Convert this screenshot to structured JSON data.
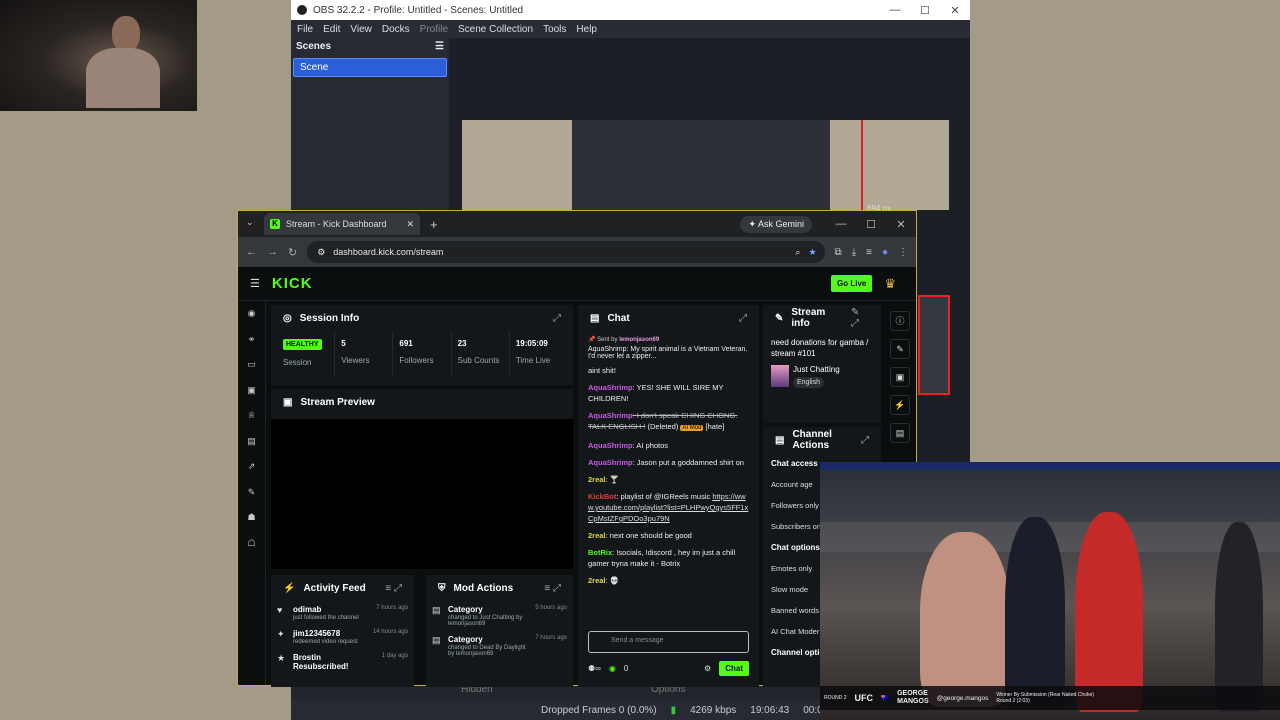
{
  "obs": {
    "title": "OBS 32.2.2 - Profile: Untitled - Scenes: Untitled",
    "menu": [
      "File",
      "Edit",
      "View",
      "Docks",
      "Profile",
      "Scene Collection",
      "Tools",
      "Help"
    ],
    "scenes_header": "Scenes",
    "scene_item": "Scene",
    "preview_px": "694 px",
    "status": {
      "dropped": "Dropped Frames 0 (0.0%)",
      "kbps": "4269 kbps",
      "time": "19:06:43",
      "rec": "00:00:00"
    },
    "dock_labels": [
      "Hidden",
      "Options"
    ]
  },
  "browser": {
    "tab_title": "Stream - Kick Dashboard",
    "ask_gemini": "Ask Gemini",
    "url": "dashboard.kick.com/stream"
  },
  "kick": {
    "logo": "KICK",
    "go_live": "Go Live",
    "session": {
      "title": "Session Info",
      "health": "HEALTHY",
      "health_label": "Session",
      "stats": [
        {
          "value": "5",
          "label": "Viewers"
        },
        {
          "value": "691",
          "label": "Followers"
        },
        {
          "value": "23",
          "label": "Sub Counts"
        },
        {
          "value": "19:05:09",
          "label": "Time Live"
        }
      ]
    },
    "preview_title": "Stream Preview",
    "activity": {
      "title": "Activity Feed",
      "items": [
        {
          "name": "odimab",
          "sub": "just followed the channel",
          "time": "7 hours ago"
        },
        {
          "name": "jim12345678",
          "sub": "redeemed video request",
          "time": "14 hours ago"
        },
        {
          "name": "Brostin Resubscribed!",
          "sub": "",
          "time": "1 day ago"
        }
      ]
    },
    "mod": {
      "title": "Mod Actions",
      "items": [
        {
          "name": "Category",
          "sub": "changed to Just Chatting by lemonjason69",
          "time": "5 hours ago"
        },
        {
          "name": "Category",
          "sub": "changed to Dead By Daylight by lemonjason69",
          "time": "7 hours ago"
        }
      ]
    },
    "chat": {
      "title": "Chat",
      "pinned_by": "Sent by",
      "pinned_user": "lemonjason69",
      "pinned_msg": "AquaShrimp: My spirit animal is a Vietnam Veteran. I'd never let a zipper...",
      "messages": [
        {
          "user": "",
          "text": "aint shit!"
        },
        {
          "user": "AquaShrimp",
          "text": ": YES! SHE WILL SIRE MY CHILDREN!"
        },
        {
          "user": "AquaShrimp",
          "text": ": I don't speak CHING CHONG. TALK ENGLISH !",
          "deleted": "(Deleted)",
          "badge": "AI Mod",
          "tag": "[hate]"
        },
        {
          "user": "AquaShrimp",
          "text": ": AI photos"
        },
        {
          "user": "AquaShrimp",
          "text": ": Jason put a goddamned shirt on"
        },
        {
          "user": "2real",
          "text": ": 🍸"
        },
        {
          "user": "KickBot",
          "text": ": playlist of @IGReels music",
          "link": "https://www.youtube.com/playlist?list=PLHPwyQgys5FF1xCpMstZFgPDOo3pu79N"
        },
        {
          "user": "2real",
          "text": ": next one should be good"
        },
        {
          "user": "BotRix",
          "text": ": !socials, !discord , hey im just a chill gamer tryna make it - Botrix"
        },
        {
          "user": "2real",
          "text": ": 💀"
        }
      ],
      "send_placeholder": "Send a message",
      "viewers": "0",
      "chat_btn": "Chat"
    },
    "stream_info": {
      "title": "Stream info",
      "stream_title": "need donations for gamba / stream #101",
      "category": "Just Chatting",
      "tag": "English"
    },
    "channel_actions": {
      "title": "Channel Actions",
      "rows": [
        {
          "label": "Chat access",
          "section": true
        },
        {
          "label": "Account age",
          "section": false
        },
        {
          "label": "Followers only",
          "section": false
        },
        {
          "label": "Subscribers on",
          "section": false
        },
        {
          "label": "Chat options",
          "section": true
        },
        {
          "label": "Emotes only",
          "section": false
        },
        {
          "label": "Slow mode",
          "section": false
        },
        {
          "label": "Banned words",
          "section": false
        },
        {
          "label": "AI Chat Moder",
          "section": false
        },
        {
          "label": "Channel optio",
          "section": true
        }
      ]
    }
  },
  "video": {
    "round_label": "ROUND 2",
    "ufc": "UFC",
    "fighter_first": "GEORGE",
    "fighter_last": "MANGOS",
    "handle": "@george.mangos",
    "result": "Winner By Submission (Rear Naked Choke)",
    "result_detail": "Round 2 (2:03)"
  }
}
